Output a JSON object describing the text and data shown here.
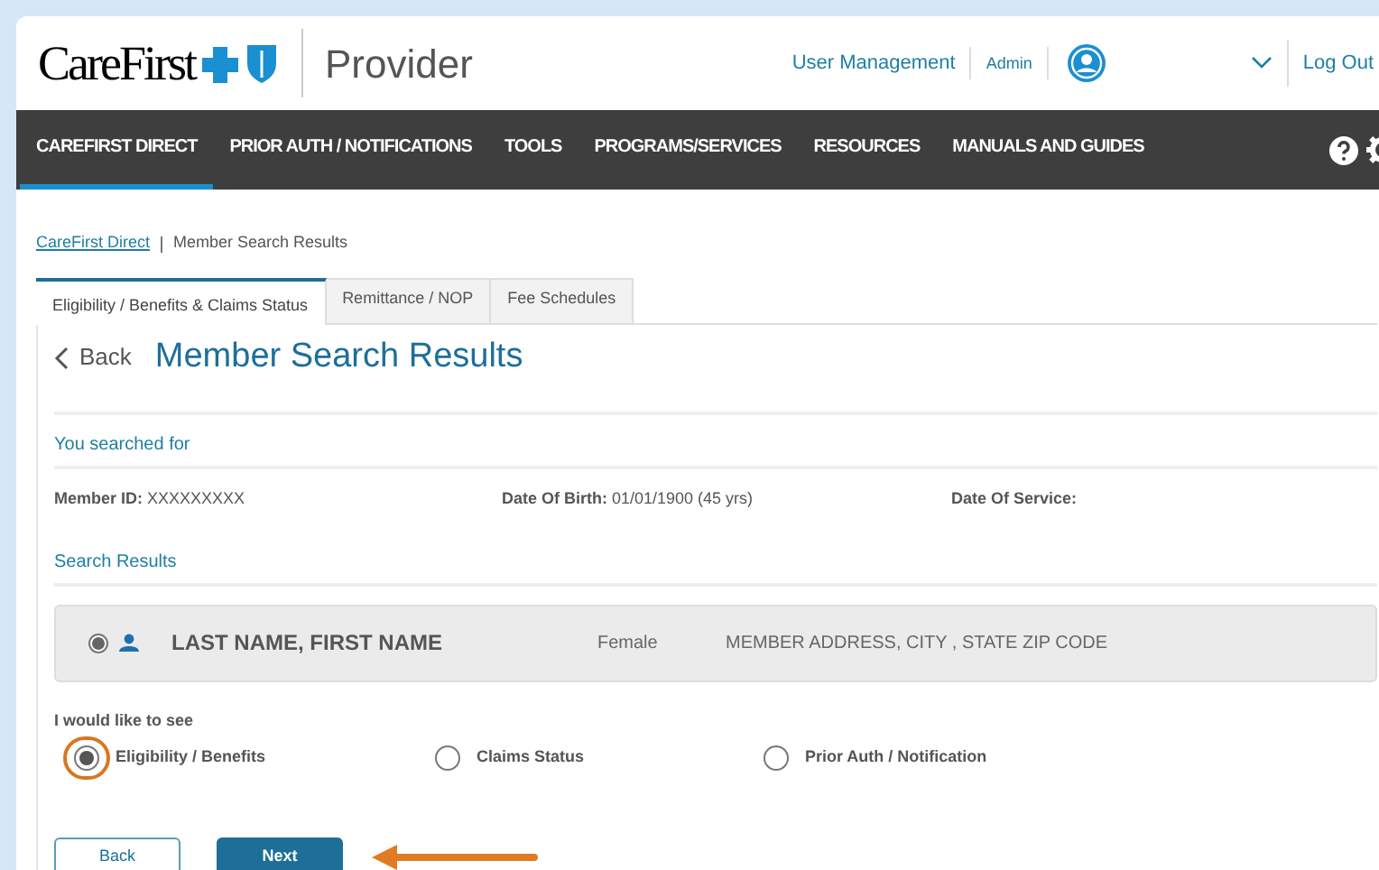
{
  "header": {
    "logo": "CareFirst",
    "product": "Provider",
    "links": [
      {
        "label": "User Management"
      },
      {
        "label": "Admin"
      }
    ],
    "logout": "Log Out"
  },
  "nav": [
    {
      "label": "CAREFIRST DIRECT",
      "selected": true
    },
    {
      "label": "PRIOR AUTH / NOTIFICATIONS",
      "selected": false
    },
    {
      "label": "TOOLS",
      "selected": false
    },
    {
      "label": "PROGRAMS/SERVICES",
      "selected": false
    },
    {
      "label": "RESOURCES",
      "selected": false
    },
    {
      "label": "MANUALS AND GUIDES",
      "selected": false
    }
  ],
  "breadcrumb": {
    "link": "CareFirst Direct",
    "current": "Member Search Results"
  },
  "tabs": [
    {
      "label": "Eligibility / Benefits & Claims Status",
      "selected": true
    },
    {
      "label": "Remittance / NOP",
      "selected": false
    },
    {
      "label": "Fee Schedules",
      "selected": false
    }
  ],
  "back": "Back",
  "title": "Member Search Results",
  "searched": {
    "heading": "You searched for",
    "fields": [
      {
        "label": "Member ID:",
        "value": "XXXXXXXXX"
      },
      {
        "label": "Date Of Birth:",
        "value": "01/01/1900 (45 yrs)"
      },
      {
        "label": "Date Of Service:"
      }
    ]
  },
  "results": {
    "heading": "Search Results",
    "rows": [
      {
        "selected": true,
        "name": "LAST NAME, FIRST NAME",
        "gender": "Female",
        "address": "MEMBER ADDRESS, CITY , STATE ZIP CODE"
      }
    ]
  },
  "options": {
    "heading": "I would like to see",
    "items": [
      {
        "label": "Eligibility / Benefits",
        "selected": true,
        "highlighted": true
      },
      {
        "label": "Claims Status",
        "selected": false,
        "highlighted": false
      },
      {
        "label": "Prior Auth / Notification",
        "selected": false,
        "highlighted": false
      }
    ]
  },
  "buttons": [
    {
      "label": "Back",
      "kind": "secondary",
      "pointer": false
    },
    {
      "label": "Next",
      "kind": "primary",
      "pointer": true
    }
  ]
}
